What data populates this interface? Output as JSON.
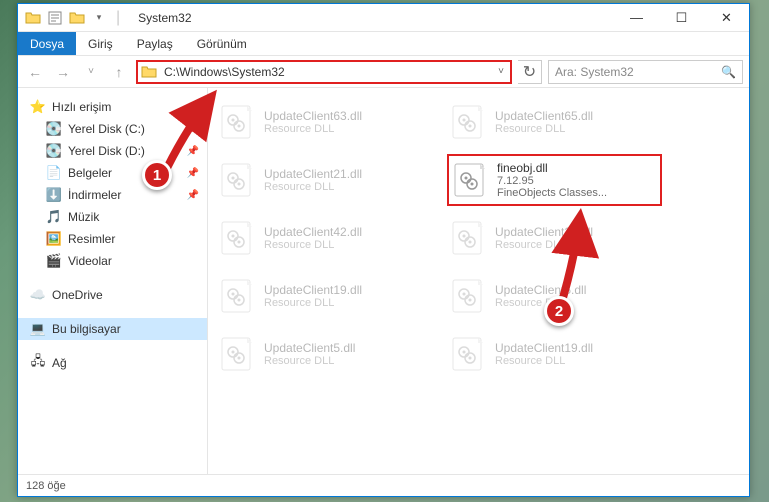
{
  "window": {
    "title": "System32"
  },
  "ribbon": {
    "file": "Dosya",
    "home": "Giriş",
    "share": "Paylaş",
    "view": "Görünüm"
  },
  "nav": {
    "address": "C:\\Windows\\System32",
    "search_placeholder": "Ara: System32"
  },
  "sidebar": {
    "quick": "Hızlı erişim",
    "c": "Yerel Disk (C:)",
    "d": "Yerel Disk (D:)",
    "docs": "Belgeler",
    "downloads": "İndirmeler",
    "music": "Müzik",
    "pictures": "Resimler",
    "videos": "Videolar",
    "onedrive": "OneDrive",
    "thispc": "Bu bilgisayar",
    "network": "Ağ"
  },
  "files": [
    {
      "name": "UpdateClient63.dll",
      "sub": "Resource DLL"
    },
    {
      "name": "UpdateClient65.dll",
      "sub": "Resource DLL"
    },
    {
      "name": "UpdateClient21.dll",
      "sub": "Resource DLL"
    },
    {
      "name": "fineobj.dll",
      "sub1": "7.12.95",
      "sub2": "FineObjects Classes...",
      "hl": true
    },
    {
      "name": "UpdateClient42.dll",
      "sub": "Resource DLL"
    },
    {
      "name": "UpdateClient21.dll",
      "sub": "Resource DLL"
    },
    {
      "name": "UpdateClient19.dll",
      "sub": "Resource DLL"
    },
    {
      "name": "UpdateClient5.dll",
      "sub": "Resource DLL"
    },
    {
      "name": "UpdateClient5.dll",
      "sub": "Resource DLL"
    },
    {
      "name": "UpdateClient19.dll",
      "sub": "Resource DLL"
    }
  ],
  "status": {
    "count": "128 öğe"
  },
  "annotations": {
    "num1": "1",
    "num2": "2"
  }
}
